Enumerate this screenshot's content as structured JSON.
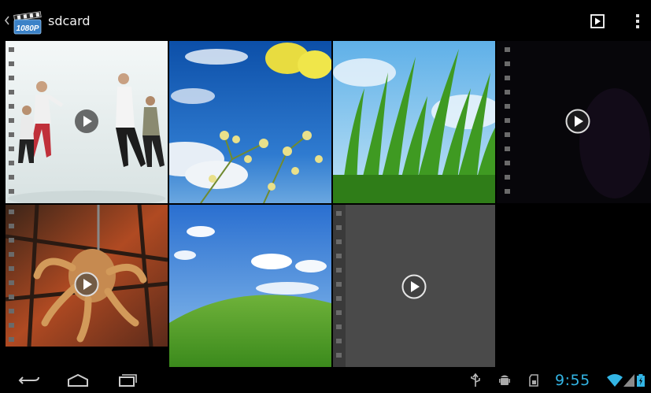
{
  "action_bar": {
    "title": "sdcard",
    "app_icon_label": "1080P",
    "app_icon": "clapperboard-icon",
    "actions": [
      "slideshow-icon",
      "overflow-menu-icon"
    ]
  },
  "gallery": {
    "items": [
      {
        "name": "dance-video",
        "type": "video"
      },
      {
        "name": "flowers-sky-photo",
        "type": "image"
      },
      {
        "name": "grass-photo",
        "type": "image"
      },
      {
        "name": "dark-video",
        "type": "video"
      },
      {
        "name": "robot-video",
        "type": "video"
      },
      {
        "name": "green-hill-photo",
        "type": "image"
      },
      {
        "name": "blank-video",
        "type": "video"
      }
    ]
  },
  "nav_bar": {
    "buttons": [
      "back-icon",
      "home-icon",
      "recent-apps-icon"
    ],
    "status_icons": [
      "usb-icon",
      "android-debug-icon",
      "sdcard-icon",
      "wifi-icon",
      "signal-icon",
      "battery-icon"
    ],
    "time": "9:55",
    "accent_color": "#33b5e5"
  }
}
